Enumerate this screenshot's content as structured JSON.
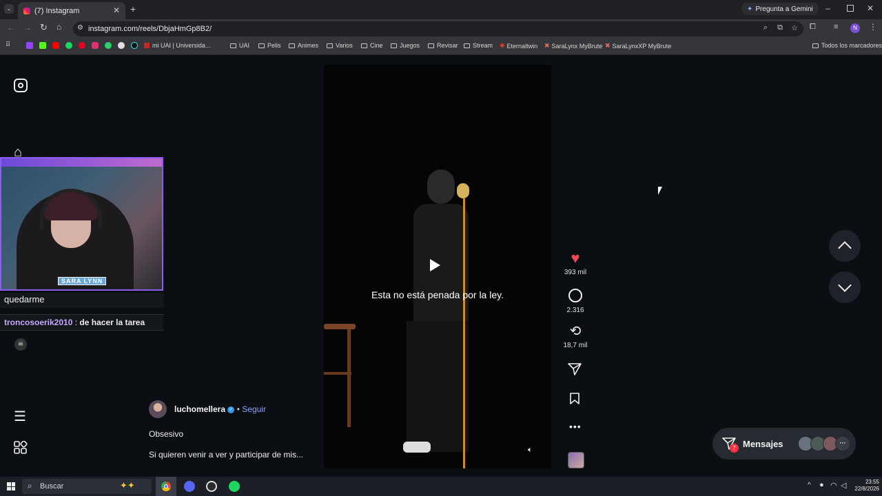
{
  "browser": {
    "tab_title": "(7) Instagram",
    "url": "instagram.com/reels/DbjaHmGp8B2/",
    "gemini_label": "Pregunta a Gemini",
    "profile_initial": "N",
    "bookmarks": [
      "mi UAI | Universida...",
      "UAI",
      "Pelis",
      "Animes",
      "Varios",
      "Cine",
      "Juegos",
      "Revisar",
      "Stream",
      "Eternaltwin",
      "SaraLynx MyBrute",
      "SaraLynxXP MyBrute"
    ],
    "all_bookmarks": "Todos los marcadores"
  },
  "reel": {
    "subtitle": "Esta no está penada por la ley.",
    "likes": "393 mil",
    "comments": "2.316",
    "reposts": "18,7 mil",
    "author": "luchomellera",
    "follow": "Seguir",
    "separator": "•",
    "title": "Obsesivo",
    "description": "Si quieren venir a ver y participar de mis..."
  },
  "messages": {
    "label": "Mensajes",
    "badge": "7"
  },
  "overlay": {
    "cam_name": "SARA LYNN",
    "chat_1": "quedarme",
    "chat_2_user": "troncosoerik2010",
    "chat_2_sep": ":",
    "chat_2_msg": "de hacer la tarea"
  },
  "taskbar": {
    "search_placeholder": "Buscar",
    "time": "23:55",
    "date": "22/8/2026"
  },
  "colors": {
    "like": "#ed4956",
    "verified": "#3897f0",
    "follow": "#8aa4ff",
    "chat_user": "#c8a8ff",
    "cam_border": "#8d5cf0"
  }
}
